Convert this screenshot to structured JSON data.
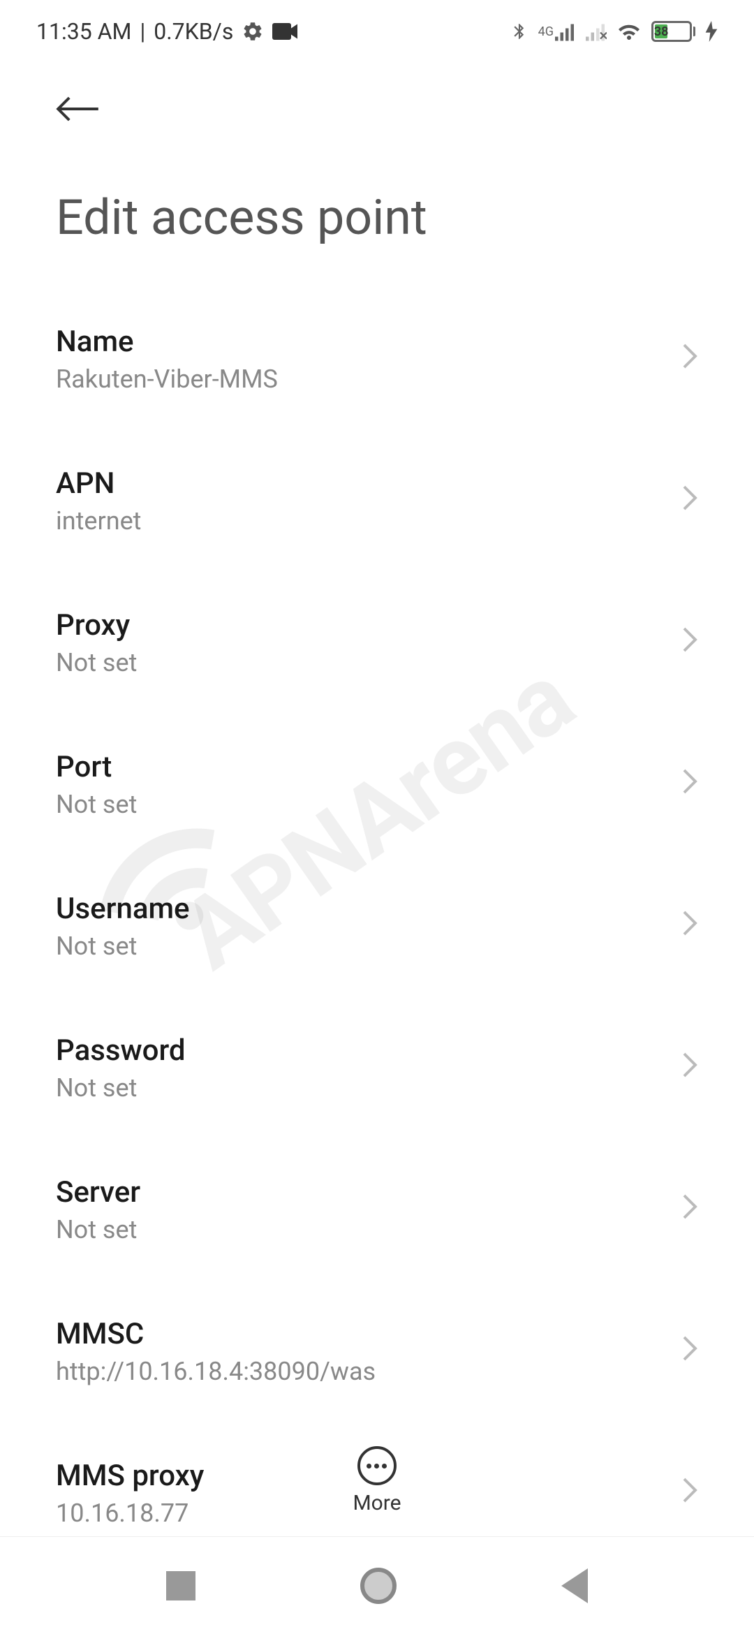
{
  "status_bar": {
    "time": "11:35 AM",
    "data_rate": "0.7KB/s",
    "network_label": "4G",
    "battery_percent": "38"
  },
  "header": {
    "title": "Edit access point"
  },
  "settings": [
    {
      "label": "Name",
      "value": "Rakuten-Viber-MMS"
    },
    {
      "label": "APN",
      "value": "internet"
    },
    {
      "label": "Proxy",
      "value": "Not set"
    },
    {
      "label": "Port",
      "value": "Not set"
    },
    {
      "label": "Username",
      "value": "Not set"
    },
    {
      "label": "Password",
      "value": "Not set"
    },
    {
      "label": "Server",
      "value": "Not set"
    },
    {
      "label": "MMSC",
      "value": "http://10.16.18.4:38090/was"
    },
    {
      "label": "MMS proxy",
      "value": "10.16.18.77"
    }
  ],
  "bottom": {
    "more_label": "More"
  },
  "watermark": {
    "text": "APNArena"
  }
}
